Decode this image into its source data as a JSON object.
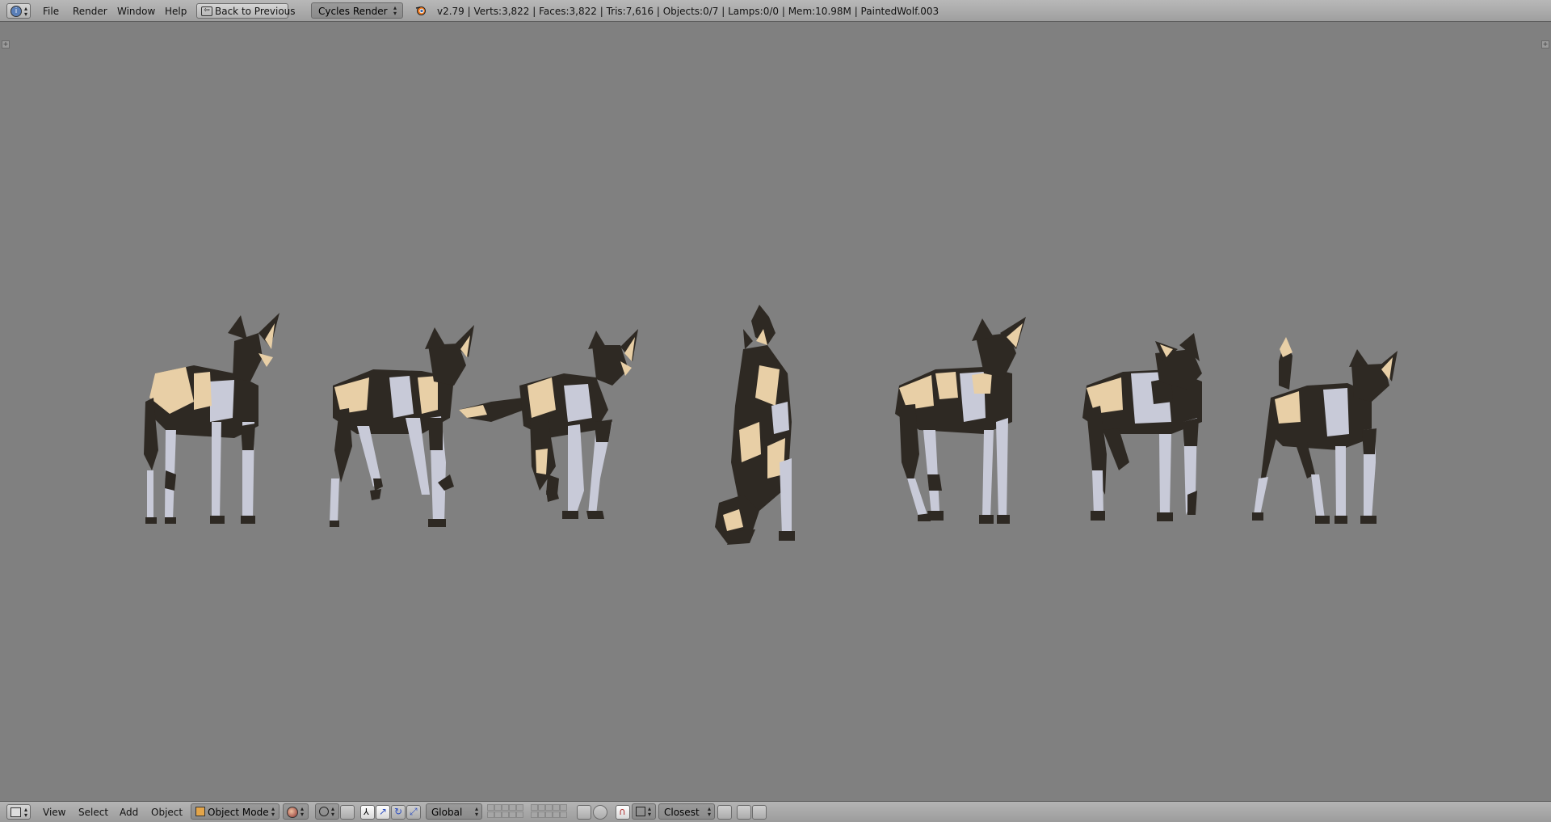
{
  "topbar": {
    "menus": [
      "File",
      "Render",
      "Window",
      "Help"
    ],
    "back_button": "Back to Previous",
    "render_engine": "Cycles Render",
    "status": "v2.79 | Verts:3,822 | Faces:3,822 | Tris:7,616 | Objects:0/7 | Lamps:0/0 | Mem:10.98M | PaintedWolf.003"
  },
  "bottombar": {
    "menus": [
      "View",
      "Select",
      "Add",
      "Object"
    ],
    "mode": "Object Mode",
    "orientation": "Global",
    "snap_target": "Closest"
  },
  "viewport": {
    "background_color": "#808080",
    "objects": [
      "painted-wolf-1",
      "painted-wolf-2",
      "painted-wolf-3",
      "painted-wolf-sitting",
      "painted-wolf-5",
      "painted-wolf-6",
      "painted-wolf-7"
    ]
  },
  "colors": {
    "fur_dark": "#2e2923",
    "fur_tan": "#e8cfa6",
    "fur_white": "#c8cad8"
  }
}
